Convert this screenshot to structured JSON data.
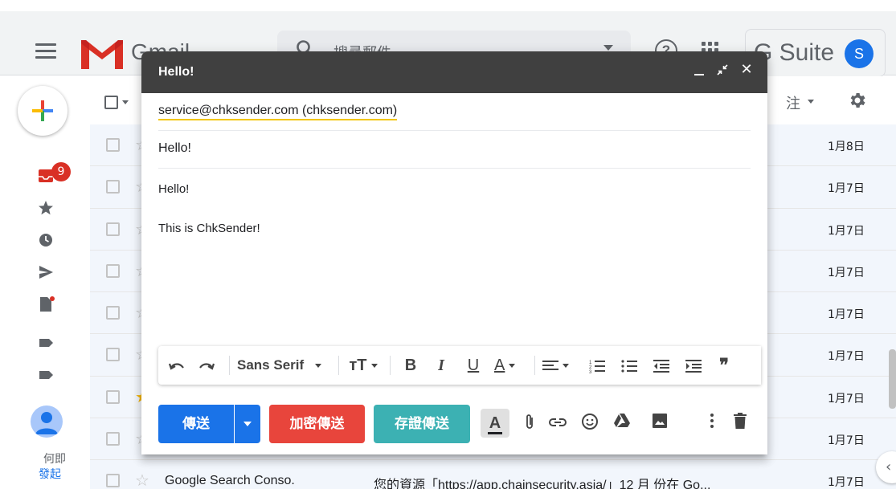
{
  "app": {
    "wordmark": "Gmail",
    "search_placeholder": "搜尋郵件",
    "gsuite_label": "G Suite",
    "account_initial": "S"
  },
  "sidebar": {
    "inbox_badge": "9",
    "footer_text_1": "何即",
    "footer_text_2": "發起"
  },
  "list_header": {
    "note_label": "注"
  },
  "emails": [
    {
      "sender": "",
      "snippet": "",
      "date": "1月8日",
      "starred": false
    },
    {
      "sender": "",
      "snippet": "",
      "date": "1月7日",
      "starred": false
    },
    {
      "sender": "",
      "snippet": "",
      "date": "1月7日",
      "starred": false
    },
    {
      "sender": "",
      "snippet": "",
      "date": "1月7日",
      "starred": false
    },
    {
      "sender": "",
      "snippet": "",
      "date": "1月7日",
      "starred": false
    },
    {
      "sender": "",
      "snippet": "",
      "date": "1月7日",
      "starred": false
    },
    {
      "sender": "",
      "snippet": "",
      "date": "1月7日",
      "starred": true
    },
    {
      "sender": "",
      "snippet": "",
      "date": "1月7日",
      "starred": false
    },
    {
      "sender": "Google Search Conso.",
      "snippet": "您的資源「https://app.chainsecurity.asia/」12 月 份在 Go...",
      "date": "1月7日",
      "starred": false
    }
  ],
  "compose": {
    "title": "Hello!",
    "to": "service@chksender.com (chksender.com)",
    "subject": "Hello!",
    "body_line_1": "Hello!",
    "body_line_2": "This is ChkSender!",
    "toolbar": {
      "font_name": "Sans Serif",
      "bold": "B",
      "italic": "I",
      "underline": "U",
      "text_color": "A",
      "quote": "❞"
    },
    "actions": {
      "send": "傳送",
      "encrypt_send": "加密傳送",
      "certified_send": "存證傳送",
      "formatting": "A"
    }
  },
  "colors": {
    "send_button": "#1a73e8",
    "encrypt_button": "#e8453c",
    "certified_button": "#3cb1b3",
    "title_bar": "#404040",
    "badge": "#d93025"
  }
}
